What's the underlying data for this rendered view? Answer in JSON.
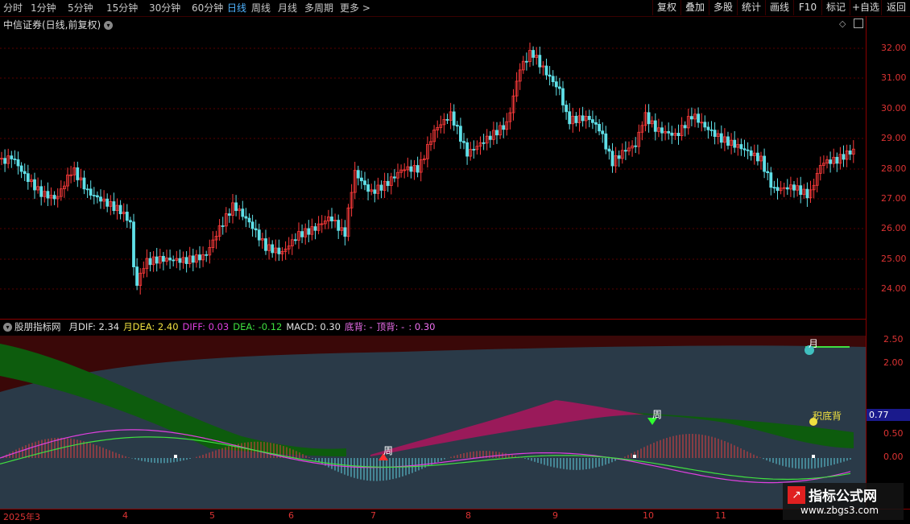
{
  "toolbar": {
    "timeframes": [
      "分时",
      "1分钟",
      "5分钟",
      "15分钟",
      "30分钟",
      "60分钟",
      "日线",
      "周线",
      "月线",
      "多周期",
      "更多 >"
    ],
    "active": "日线",
    "right_buttons": [
      "复权",
      "叠加",
      "多股",
      "统计",
      "画线",
      "F10",
      "标记",
      "+自选",
      "返回"
    ]
  },
  "stock": {
    "title": "中信证券(日线,前复权)"
  },
  "indicator": {
    "name": "股朋指标网",
    "labels": [
      {
        "text": "月DIF: 2.34",
        "color": "#e0e0e0"
      },
      {
        "text": "月DEA: 2.40",
        "color": "#f0e040"
      },
      {
        "text": "DIFF: 0.03",
        "color": "#e040e0"
      },
      {
        "text": "DEA: -0.12",
        "color": "#40e040"
      },
      {
        "text": "MACD: 0.30",
        "color": "#e0e0e0"
      },
      {
        "text": "底背: -",
        "color": "#f070f0"
      },
      {
        "text": "顶背: -",
        "color": "#f070f0"
      },
      {
        "text": ": 0.30",
        "color": "#f070f0"
      }
    ],
    "markers": {
      "zhou": "周",
      "yue": "月",
      "dibei": "积底背"
    }
  },
  "main_axis": [
    "32.00",
    "31.00",
    "30.00",
    "29.00",
    "28.00",
    "27.00",
    "26.00",
    "25.00",
    "24.00"
  ],
  "sub_axis": [
    "2.50",
    "2.00",
    "0.50",
    "0.00"
  ],
  "sub_current": "0.77",
  "date_axis": [
    "2025年3",
    "4",
    "5",
    "6",
    "7",
    "8",
    "9",
    "10",
    "11"
  ],
  "watermark": {
    "title": "指标公式网",
    "url": "www.zbgs3.com"
  },
  "colors": {
    "up": "#ff3b3b",
    "down": "#5fe0e8",
    "grid": "#5a0000"
  }
}
